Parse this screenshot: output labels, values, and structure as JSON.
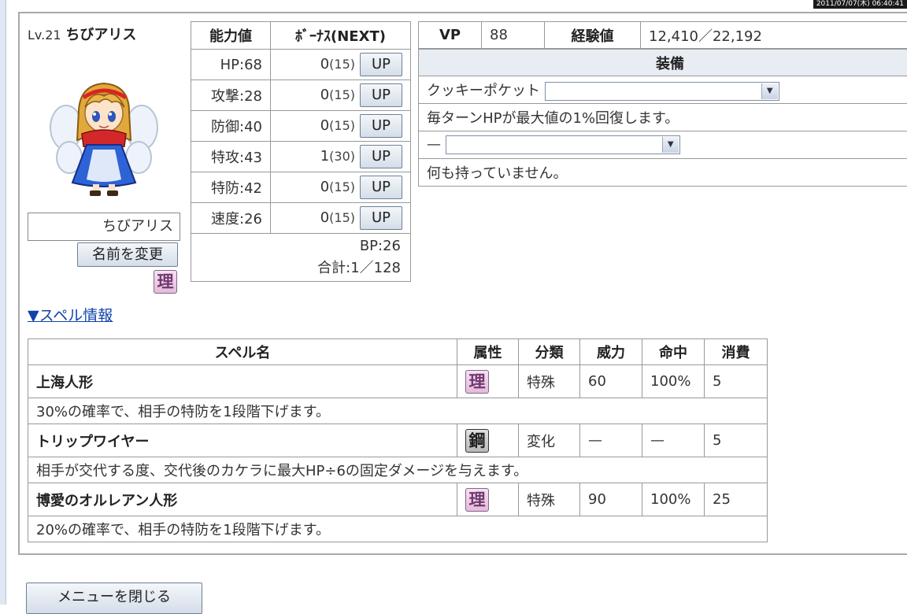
{
  "datetime": "2011/07/07(木) 06:40:41",
  "character": {
    "level_label": "Lv.21",
    "name": "ちびアリス",
    "name_field_value": "ちびアリス",
    "rename_label": "名前を変更",
    "attribute_glyph": "理"
  },
  "stats": {
    "header_name": "能力値",
    "header_bonus": "ﾎﾞｰﾅｽ(NEXT)",
    "up_label": "UP",
    "rows": [
      {
        "label": "HP:68",
        "bonus": "0",
        "next": "(15)"
      },
      {
        "label": "攻撃:28",
        "bonus": "0",
        "next": "(15)"
      },
      {
        "label": "防御:40",
        "bonus": "0",
        "next": "(15)"
      },
      {
        "label": "特攻:43",
        "bonus": "1",
        "next": "(30)"
      },
      {
        "label": "特防:42",
        "bonus": "0",
        "next": "(15)"
      },
      {
        "label": "速度:26",
        "bonus": "0",
        "next": "(15)"
      }
    ],
    "bp": "BP:26",
    "total": "合計:1／128"
  },
  "vp": {
    "label": "VP",
    "value": "88",
    "exp_label": "経験値",
    "exp_value": "12,410／22,192"
  },
  "equipment": {
    "header": "装備",
    "slot1_name": "クッキーポケット",
    "slot1_desc": "毎ターンHPが最大値の1%回復します。",
    "slot2_name": "—",
    "slot2_desc": "何も持っていません。"
  },
  "spell_link": "▼スペル情報",
  "spell_table": {
    "headers": [
      "スペル名",
      "属性",
      "分類",
      "威力",
      "命中",
      "消費"
    ],
    "rows": [
      {
        "name": "上海人形",
        "attr": "理",
        "category": "特殊",
        "power": "60",
        "accuracy": "100%",
        "cost": "5",
        "desc": "30%の確率で、相手の特防を1段階下げます。"
      },
      {
        "name": "トリップワイヤー",
        "attr": "鋼",
        "category": "変化",
        "power": "—",
        "accuracy": "—",
        "cost": "5",
        "desc": "相手が交代する度、交代後のカケラに最大HP÷6の固定ダメージを与えます。"
      },
      {
        "name": "博愛のオルレアン人形",
        "attr": "理",
        "category": "特殊",
        "power": "90",
        "accuracy": "100%",
        "cost": "25",
        "desc": "20%の確率で、相手の特防を1段階下げます。"
      }
    ]
  },
  "close_menu_label": "メニューを閉じる",
  "colors": {
    "link": "#1144aa",
    "header_bg": "#e8edf3",
    "attr_ri": "#e6b9dc",
    "attr_steel": "#b9b9b9"
  }
}
